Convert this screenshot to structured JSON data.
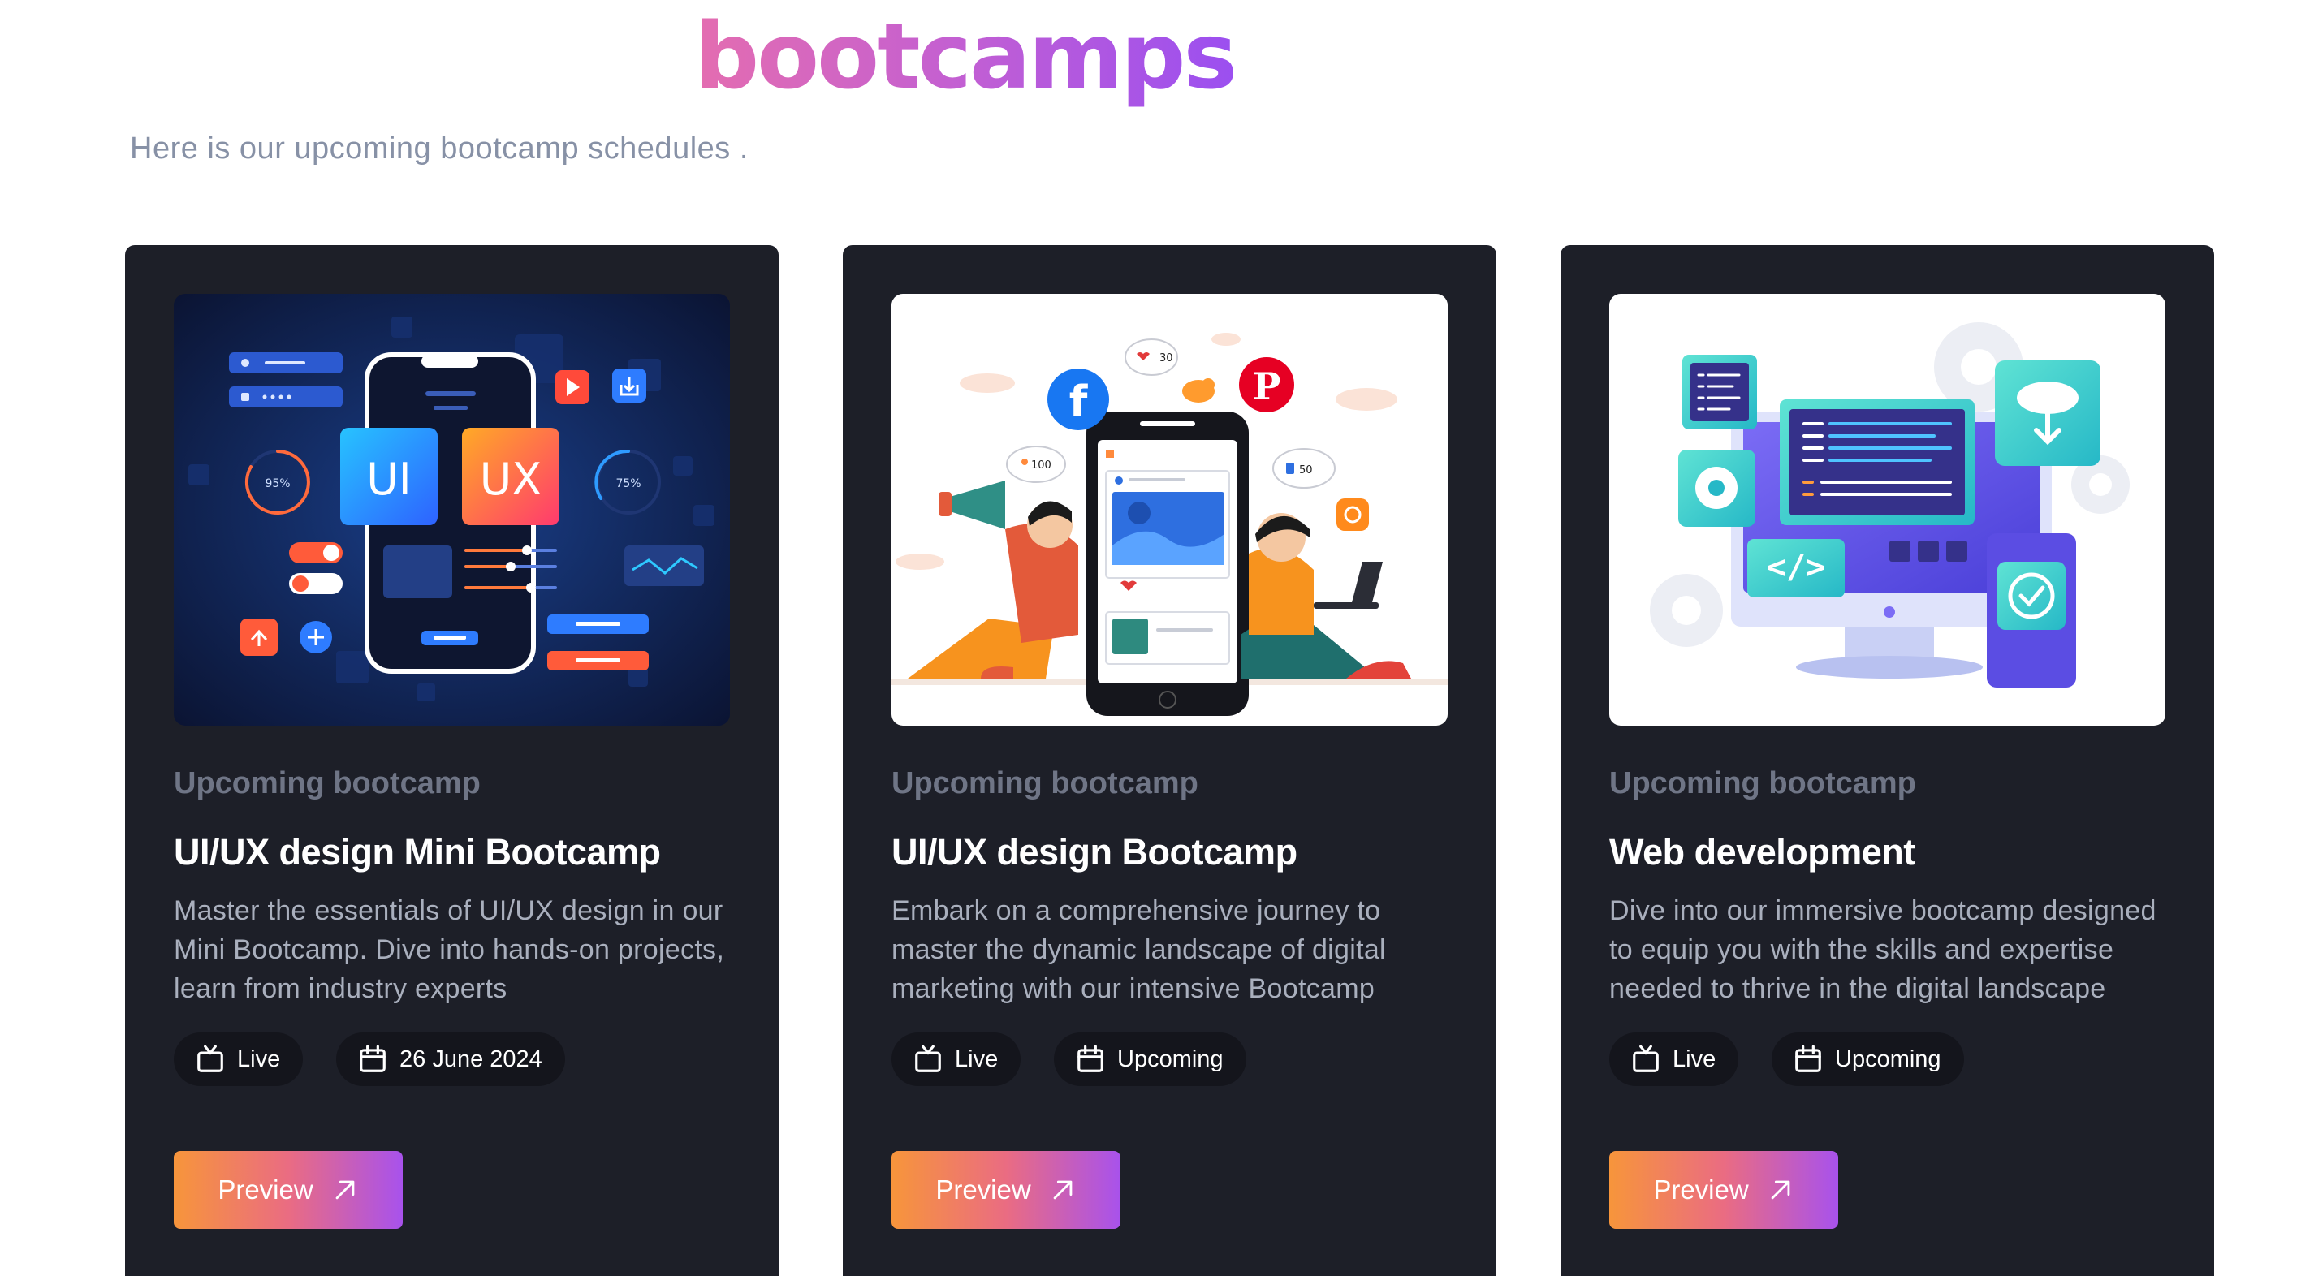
{
  "header": {
    "title": "bootcamps",
    "subtitle": "Here is our upcoming bootcamp schedules ."
  },
  "cards": [
    {
      "eyebrow": "Upcoming bootcamp",
      "title": "UI/UX design Mini Bootcamp",
      "description": "Master the essentials of UI/UX design in our Mini Bootcamp. Dive into hands-on projects, learn from industry experts",
      "mode": "Live",
      "date": "26 June 2024",
      "button": "Preview",
      "illustration": {
        "labels": [
          "UI",
          "UX",
          "95%",
          "75%"
        ]
      }
    },
    {
      "eyebrow": "Upcoming bootcamp",
      "title": "UI/UX design Bootcamp",
      "description": "Embark on a comprehensive journey to master the dynamic landscape of digital marketing with our intensive Bootcamp",
      "mode": "Live",
      "date": "Upcoming",
      "button": "Preview",
      "illustration": {
        "labels": [
          "100",
          "30",
          "50"
        ]
      }
    },
    {
      "eyebrow": "Upcoming bootcamp",
      "title": "Web development",
      "description": "Dive into our immersive bootcamp designed to equip you with the skills and expertise needed to thrive in the digital landscape",
      "mode": "Live",
      "date": "Upcoming",
      "button": "Preview",
      "illustration": {
        "labels": [
          "</>"
        ]
      }
    }
  ],
  "colors": {
    "card_background": "#1d1f28",
    "chip_background": "#14151c",
    "button_gradient": [
      "#f7953b",
      "#ea6c82",
      "#a852ec"
    ],
    "heading_gradient": [
      "#e46db0",
      "#9b4ff0"
    ],
    "subtitle": "#8791a6"
  },
  "icons": {
    "live": "tv-icon",
    "date": "calendar-icon",
    "button": "arrow-up-right-icon"
  }
}
